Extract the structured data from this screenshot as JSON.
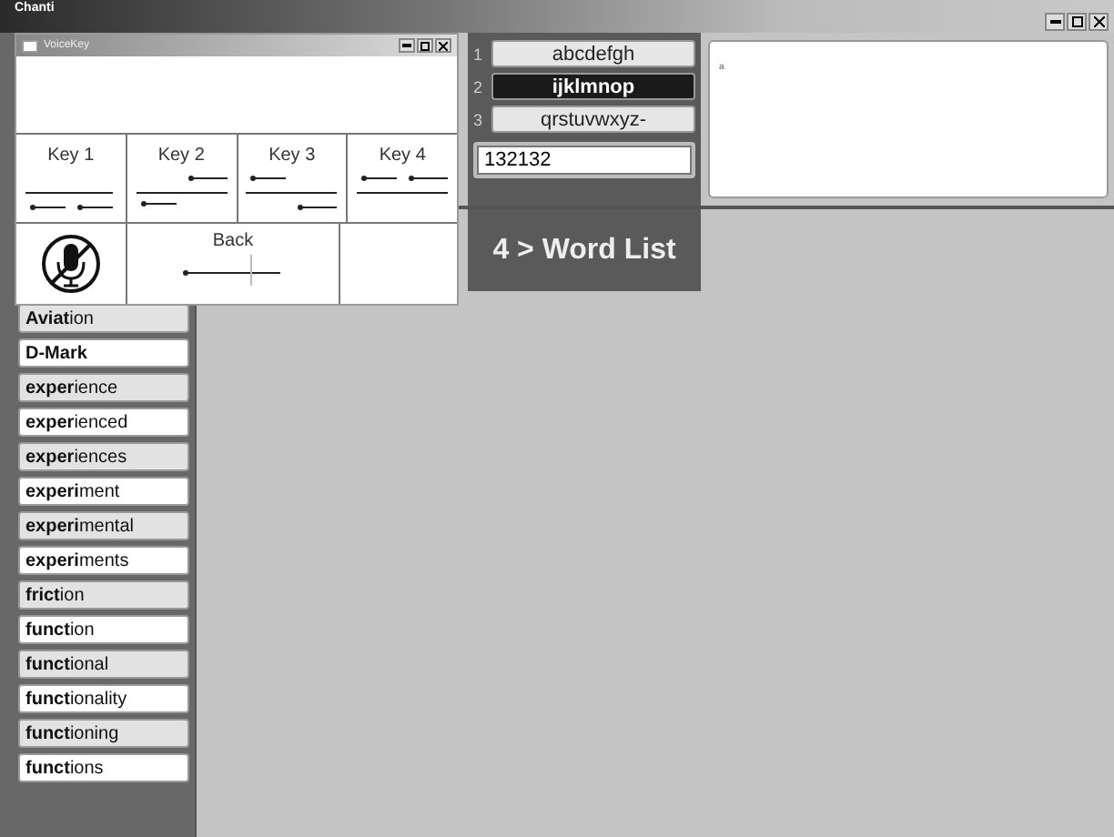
{
  "window": {
    "title": "Chanti"
  },
  "voicekey": {
    "title": "VoiceKey",
    "keys": [
      {
        "label": "Key 1"
      },
      {
        "label": "Key 2"
      },
      {
        "label": "Key 3"
      },
      {
        "label": "Key 4"
      }
    ],
    "mic": {
      "muted": true
    },
    "back": {
      "label": "Back"
    }
  },
  "letter_groups": [
    {
      "number": "1",
      "label": "abcdefgh",
      "selected": false
    },
    {
      "number": "2",
      "label": "ijklmnop",
      "selected": true
    },
    {
      "number": "3",
      "label": "qrstuvwxyz-",
      "selected": false
    }
  ],
  "code_field": {
    "value": "132132"
  },
  "text_area": {
    "value": "a"
  },
  "word_list_button": {
    "label": "4 > Word List"
  },
  "words": [
    "**Aviat**ion",
    "**D-Mark**",
    "**exper**ience",
    "**exper**ienced",
    "**exper**iences",
    "**experi**ment",
    "**experi**mental",
    "**experi**ments",
    "**frict**ion",
    "**funct**ion",
    "**funct**ional",
    "**funct**ionality",
    "**funct**ioning",
    "**funct**ions"
  ]
}
